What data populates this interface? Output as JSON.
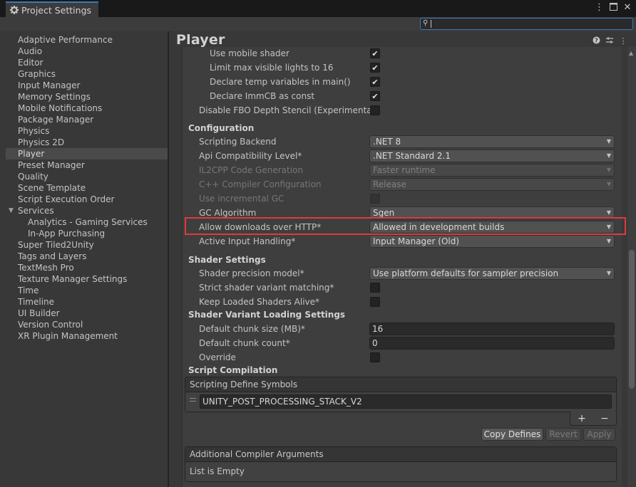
{
  "window": {
    "tab_title": "Project Settings",
    "tab_icon": "gear-icon",
    "buttons": [
      "more-menu-icon",
      "maximize-icon",
      "close-icon"
    ]
  },
  "search": {
    "placeholder": "",
    "value": ""
  },
  "sidebar": {
    "items": [
      {
        "label": "Adaptive Performance"
      },
      {
        "label": "Audio"
      },
      {
        "label": "Editor"
      },
      {
        "label": "Graphics"
      },
      {
        "label": "Input Manager"
      },
      {
        "label": "Memory Settings"
      },
      {
        "label": "Mobile Notifications"
      },
      {
        "label": "Package Manager"
      },
      {
        "label": "Physics"
      },
      {
        "label": "Physics 2D"
      },
      {
        "label": "Player",
        "selected": true
      },
      {
        "label": "Preset Manager"
      },
      {
        "label": "Quality"
      },
      {
        "label": "Scene Template"
      },
      {
        "label": "Script Execution Order"
      },
      {
        "label": "Services",
        "expanded": true
      },
      {
        "label": "Analytics - Gaming Services",
        "child": true
      },
      {
        "label": "In-App Purchasing",
        "child": true
      },
      {
        "label": "Super Tiled2Unity"
      },
      {
        "label": "Tags and Layers"
      },
      {
        "label": "TextMesh Pro"
      },
      {
        "label": "Texture Manager Settings"
      },
      {
        "label": "Time"
      },
      {
        "label": "Timeline"
      },
      {
        "label": "UI Builder"
      },
      {
        "label": "Version Control"
      },
      {
        "label": "XR Plugin Management"
      }
    ]
  },
  "header": {
    "title": "Player",
    "icons": [
      "help-icon",
      "preset-icon",
      "more-menu-icon"
    ]
  },
  "graphics_rows": {
    "use_mobile_shader": {
      "label": "Use mobile shader",
      "checked": true
    },
    "limit_lights": {
      "label": "Limit max visible lights to 16",
      "checked": true
    },
    "declare_temp": {
      "label": "Declare temp variables in main()",
      "checked": true
    },
    "declare_immcb": {
      "label": "Declare ImmCB as const",
      "checked": true
    },
    "disable_fbo": {
      "label": "Disable FBO Depth Stencil (Experimental)",
      "checked": false
    }
  },
  "configuration": {
    "title": "Configuration",
    "scripting_backend": {
      "label": "Scripting Backend",
      "value": ".NET 8"
    },
    "api_compat": {
      "label": "Api Compatibility Level*",
      "value": ".NET Standard 2.1"
    },
    "il2cpp": {
      "label": "IL2CPP Code Generation",
      "value": "Faster runtime"
    },
    "cpp_config": {
      "label": "C++ Compiler Configuration",
      "value": "Release"
    },
    "incremental_gc": {
      "label": "Use incremental GC",
      "checked": false
    },
    "gc_algorithm": {
      "label": "GC Algorithm",
      "value": "Sgen"
    },
    "allow_http": {
      "label": "Allow downloads over HTTP*",
      "value": "Allowed in development builds"
    },
    "input_handling": {
      "label": "Active Input Handling*",
      "value": "Input Manager (Old)"
    }
  },
  "shader_settings": {
    "title": "Shader Settings",
    "precision": {
      "label": "Shader precision model*",
      "value": "Use platform defaults for sampler precision"
    },
    "strict_matching": {
      "label": "Strict shader variant matching*",
      "checked": false
    },
    "keep_loaded": {
      "label": "Keep Loaded Shaders Alive*",
      "checked": false
    }
  },
  "variant_loading": {
    "title": "Shader Variant Loading Settings",
    "chunk_size": {
      "label": "Default chunk size (MB)*",
      "value": "16"
    },
    "chunk_count": {
      "label": "Default chunk count*",
      "value": "0"
    },
    "override": {
      "label": "Override",
      "checked": false
    }
  },
  "script_compilation": {
    "title": "Script Compilation",
    "define_symbols": {
      "header": "Scripting Define Symbols",
      "items": [
        "UNITY_POST_PROCESSING_STACK_V2"
      ]
    },
    "plus": "+",
    "minus": "−",
    "copy_defines": "Copy Defines",
    "revert": "Revert",
    "apply": "Apply",
    "compiler_args": {
      "header": "Additional Compiler Arguments",
      "empty_text": "List is Empty"
    }
  }
}
